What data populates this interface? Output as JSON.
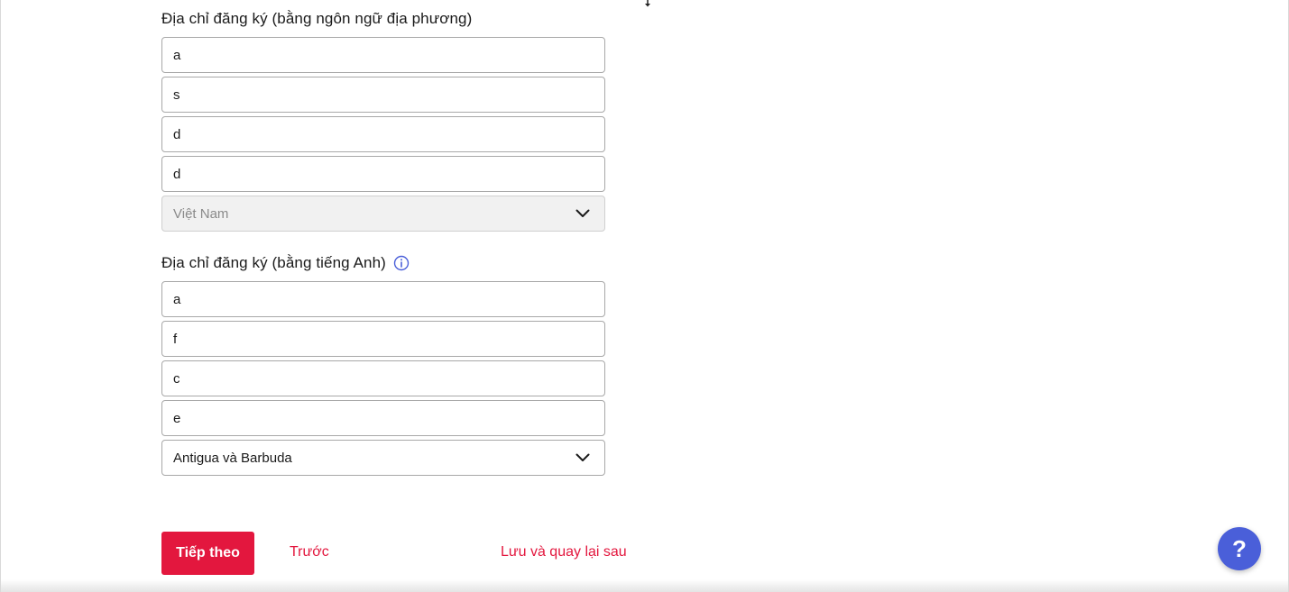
{
  "local_address": {
    "title": "Địa chỉ đăng ký (bằng ngôn ngữ địa phương)",
    "fields": [
      "a",
      "s",
      "d",
      "d"
    ],
    "country": "Việt Nam"
  },
  "english_address": {
    "title": "Địa chỉ đăng ký (bằng tiếng Anh)",
    "info_icon": "info-circle",
    "fields": [
      "a",
      "f",
      "c",
      "e"
    ],
    "country": "Antigua và Barbuda"
  },
  "footer": {
    "next_label": "Tiếp theo",
    "prev_label": "Trước",
    "save_label": "Lưu và quay lại sau"
  },
  "help": {
    "label": "?"
  },
  "colors": {
    "accent": "#e3173e",
    "help_bg": "#4a5fd9",
    "info_icon": "#4a5fd9"
  }
}
